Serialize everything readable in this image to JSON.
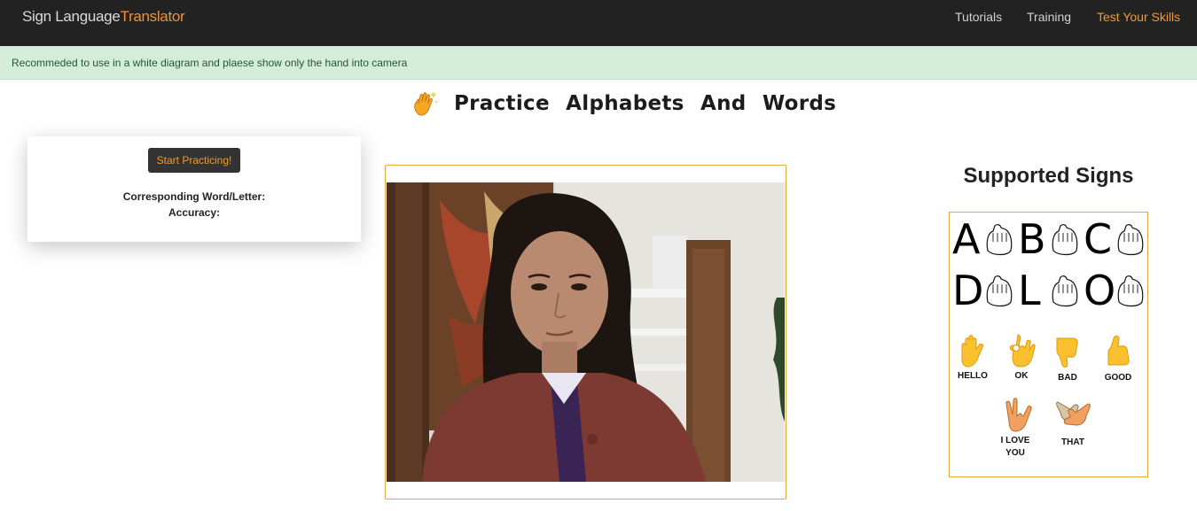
{
  "navbar": {
    "brand_part1": "Sign Language",
    "brand_part2": "Translator",
    "links": [
      {
        "label": "Tutorials"
      },
      {
        "label": "Training"
      },
      {
        "label": "Test Your Skills",
        "active": true
      }
    ]
  },
  "alert": {
    "message": "Recommeded to use in a white diagram and plaese show only the hand into camera"
  },
  "page": {
    "title": "Practice Alphabets And Words",
    "title_icon": "waving-hand-sparkles-icon"
  },
  "control": {
    "start_label": "Start Practicing!",
    "word_label": "Corresponding Word/Letter:",
    "accuracy_label": "Accuracy:"
  },
  "signs": {
    "heading": "Supported Signs",
    "letters": [
      "A",
      "B",
      "C",
      "D",
      "L",
      "O"
    ],
    "words": [
      {
        "label": "HELLO",
        "icon": "raised-hand-icon"
      },
      {
        "label": "OK",
        "icon": "ok-hand-icon"
      },
      {
        "label": "BAD",
        "icon": "thumbs-down-icon"
      },
      {
        "label": "GOOD",
        "icon": "thumbs-up-icon"
      },
      {
        "label": "I LOVE YOU",
        "icon": "love-you-gesture-icon"
      },
      {
        "label": "THAT",
        "icon": "pointing-hands-icon"
      }
    ]
  },
  "colors": {
    "accent": "#f39a2a",
    "navbar": "#222222",
    "alert_bg": "#d4eddb",
    "alert_text": "#24572f",
    "frame_border": "#e0a63a"
  }
}
